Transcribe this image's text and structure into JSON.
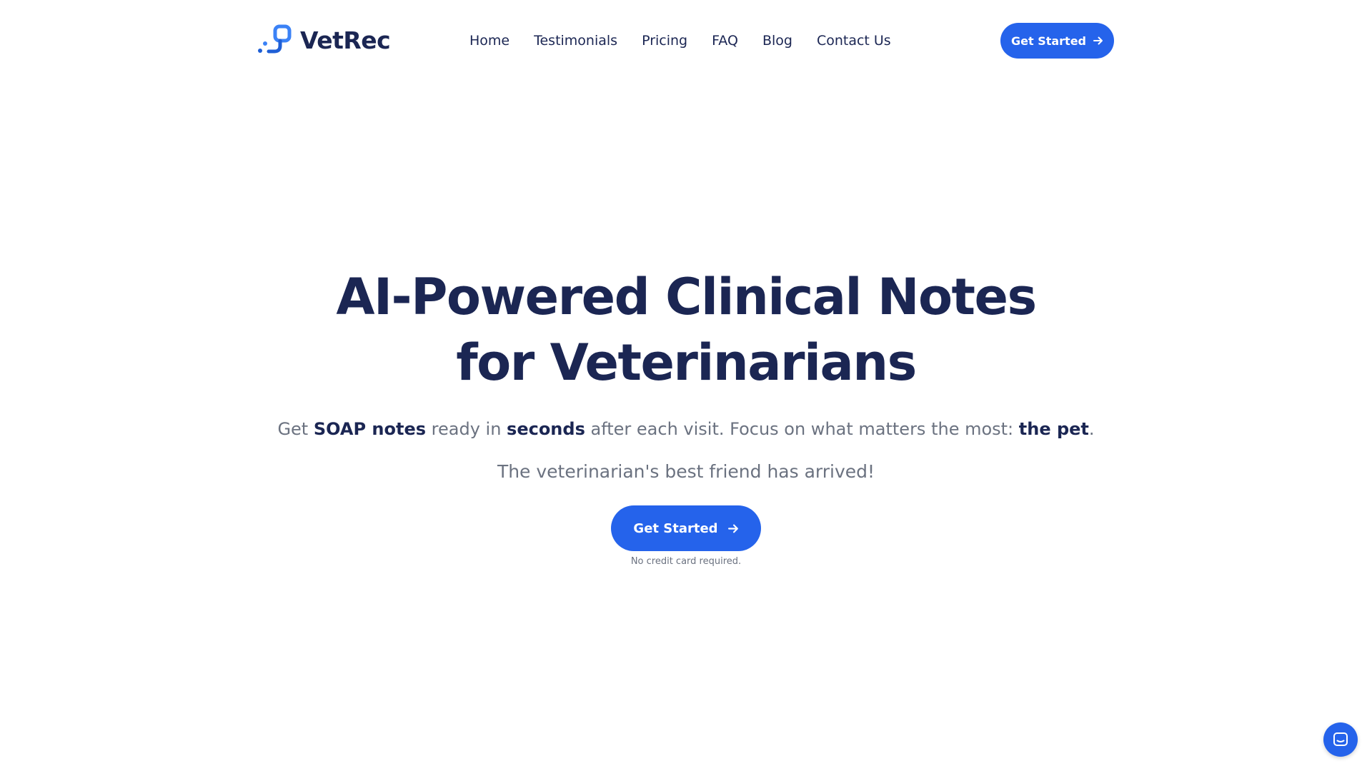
{
  "brand": {
    "name": "VetRec",
    "logo_icon": "vetrec-logo-icon"
  },
  "nav": {
    "items": [
      {
        "label": "Home"
      },
      {
        "label": "Testimonials"
      },
      {
        "label": "Pricing"
      },
      {
        "label": "FAQ"
      },
      {
        "label": "Blog"
      },
      {
        "label": "Contact Us"
      }
    ]
  },
  "header": {
    "cta_label": "Get Started",
    "cta_icon": "arrow-right-icon"
  },
  "hero": {
    "title": "AI-Powered Clinical Notes for Veterinarians",
    "subtitle": {
      "part1": "Get ",
      "strong1": "SOAP notes",
      "part2": " ready in ",
      "strong2": "seconds",
      "part3": " after each visit. Focus on what matters the most: ",
      "strong3": "the pet",
      "part4": "."
    },
    "tagline": "The veterinarian's best friend has arrived!",
    "cta_label": "Get Started",
    "cta_icon": "arrow-right-icon",
    "cta_note": "No credit card required."
  },
  "chat": {
    "icon": "chat-bubble-icon"
  },
  "colors": {
    "primary": "#2563eb",
    "heading": "#1b2653",
    "muted": "#6b7280",
    "background": "#ffffff",
    "logo_light": "#3b8df0",
    "logo_dark": "#1f5fd6"
  }
}
